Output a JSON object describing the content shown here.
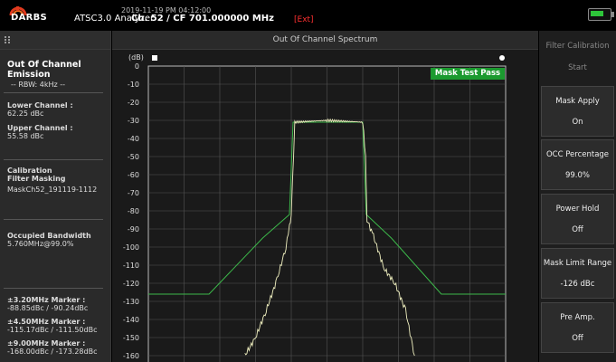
{
  "header": {
    "logo_text": "DARBS",
    "app_title": "ATSC3.0 Analyzer",
    "datetime": "2019-11-19 PM 04:12:00",
    "channel": "Ch. 52 / CF 701.000000 MHz",
    "ext": "[Ext]"
  },
  "left_panel": {
    "title_line1": "Out Of Channel",
    "title_line2": "Emission",
    "rbw": "-- RBW: 4kHz --",
    "lower_label": "Lower Channel :",
    "lower_value": "62.25 dBc",
    "upper_label": "Upper Channel :",
    "upper_value": "55.58 dBc",
    "cal_label1": "Calibration",
    "cal_label2": "Filter Masking",
    "cal_value": "MaskCh52_191119-1112",
    "obw_label": "Occupied Bandwidth",
    "obw_value": "5.760MHz@99.0%",
    "m1_label": "±3.20MHz Marker :",
    "m1_value": "-88.85dBc / -90.24dBc",
    "m2_label": "±4.50MHz Marker :",
    "m2_value": "-115.17dBc / -111.50dBc",
    "m3_label": "±9.00MHz Marker :",
    "m3_value": "-168.00dBc / -173.28dBc"
  },
  "center": {
    "title": "Out Of Channel Spectrum",
    "y_unit": "(dB)",
    "badge": "Mask Test Pass"
  },
  "right_panel": {
    "title1": "Filter Calibration",
    "title2": "Start",
    "buttons": [
      {
        "label": "Mask Apply",
        "value": "On"
      },
      {
        "label": "OCC Percentage",
        "value": "99.0%"
      },
      {
        "label": "Power Hold",
        "value": "Off"
      },
      {
        "label": "Mask Limit Range",
        "value": "-126 dBc"
      },
      {
        "label": "Pre Amp.",
        "value": "Off"
      }
    ]
  },
  "chart_data": {
    "type": "line",
    "title": "Out Of Channel Spectrum",
    "ylabel": "(dB)",
    "ylim": [
      -160,
      0
    ],
    "yticks": [
      0,
      -10,
      -20,
      -30,
      -40,
      -50,
      -60,
      -70,
      -80,
      -90,
      -100,
      -110,
      -120,
      -130,
      -140,
      -150,
      -160
    ],
    "grid": true,
    "x_divisions": 10,
    "series": [
      {
        "color": "#3cb84a",
        "x": [
          0,
          1.7,
          3.2,
          3.95,
          4.05,
          6.0,
          6.1,
          6.8,
          8.2,
          10
        ],
        "values": [
          -126,
          -126,
          -95,
          -82,
          -31,
          -31,
          -82,
          -95,
          -126,
          -126
        ]
      },
      {
        "color": "#f0f0c0",
        "x": [
          2.7,
          3.0,
          3.3,
          3.6,
          3.85,
          3.95,
          4.0,
          4.1,
          5.0,
          6.0,
          6.08,
          6.12,
          6.3,
          6.6,
          6.9,
          7.2,
          7.45
        ],
        "values": [
          -160,
          -150,
          -135,
          -118,
          -100,
          -89,
          -82,
          -31,
          -30,
          -31,
          -50,
          -85,
          -94,
          -112,
          -120,
          -135,
          -160
        ]
      }
    ]
  }
}
